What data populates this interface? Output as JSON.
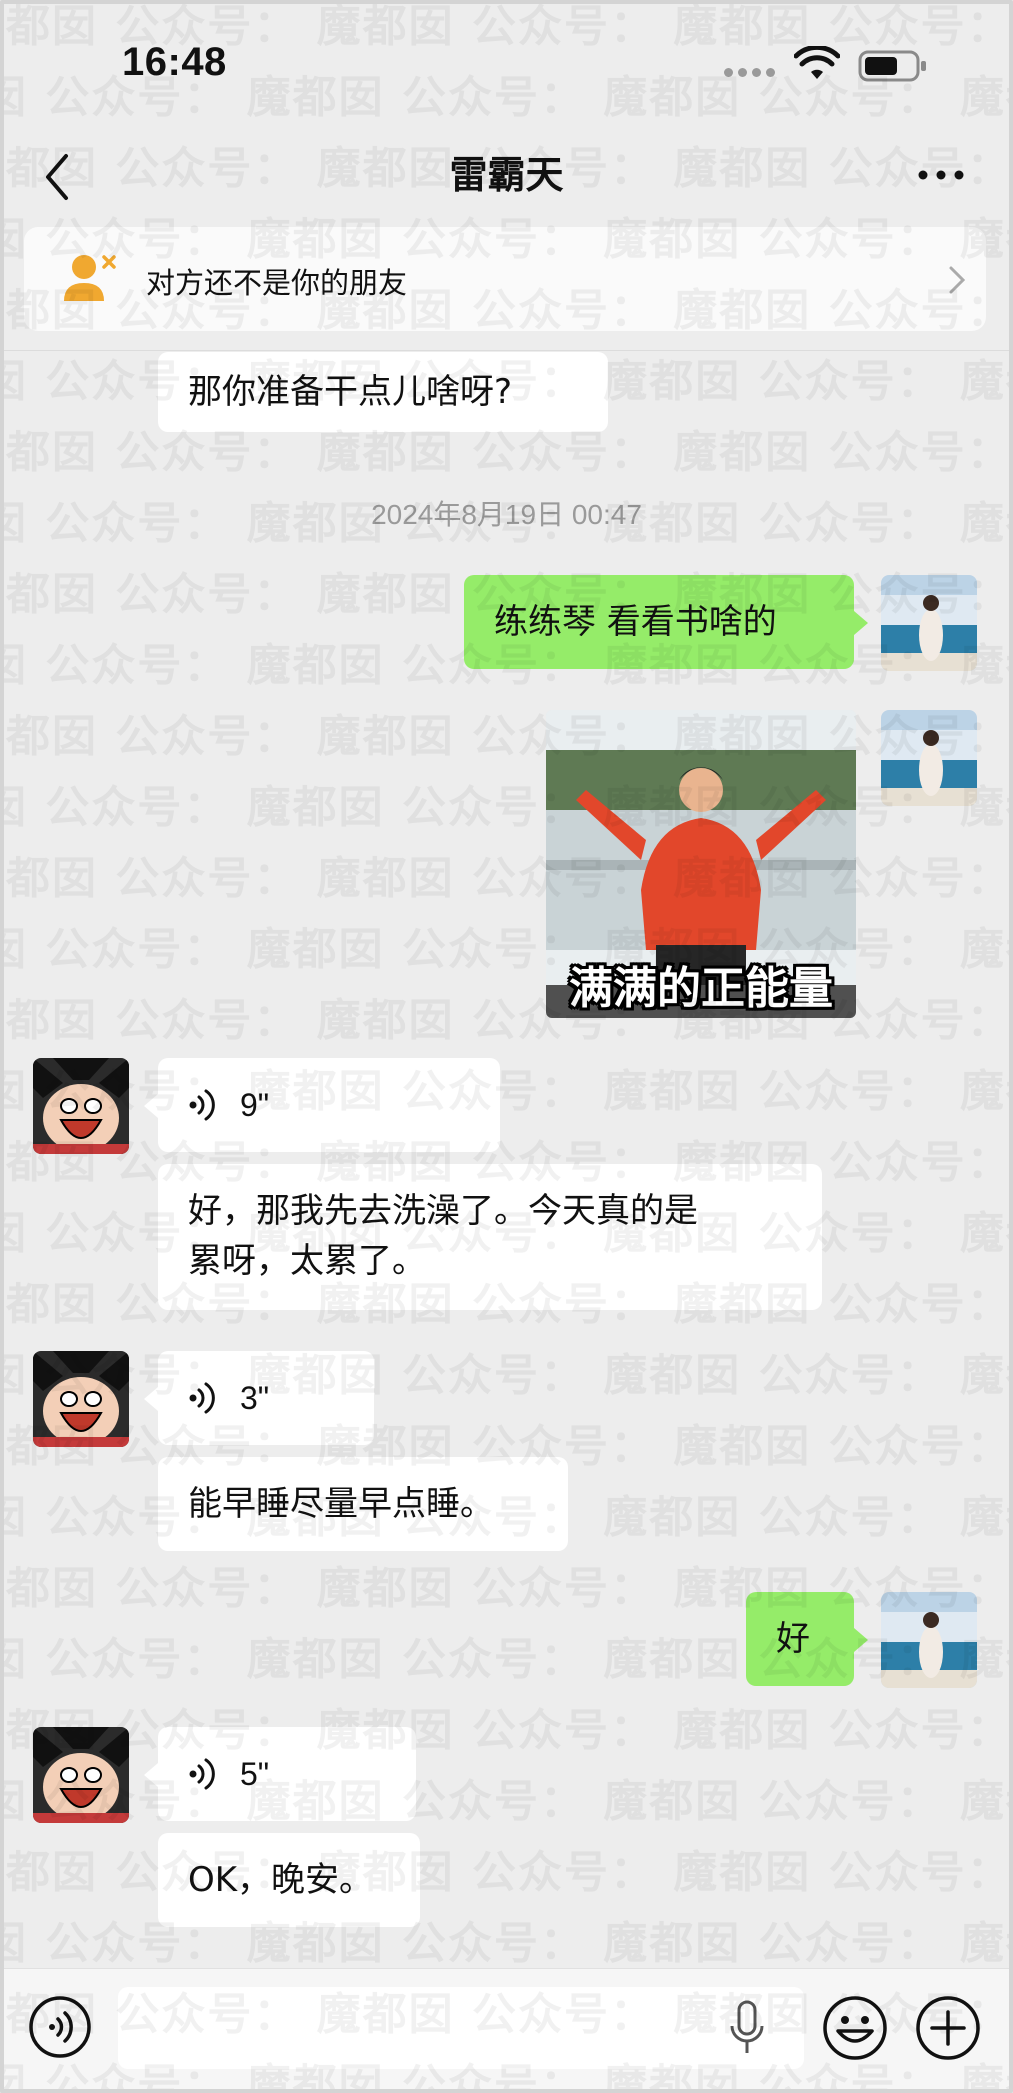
{
  "status_bar": {
    "time": "16:48"
  },
  "nav": {
    "title": "雷霸天"
  },
  "banner": {
    "text": "对方还不是你的朋友"
  },
  "messages": {
    "m1": "那你准备干点儿啥呀?",
    "timestamp": "2024年8月19日 00:47",
    "m2": "练练琴 看看书啥的",
    "sticker_caption": "满满的正能量",
    "v1": "9\"",
    "m3_line1": "好，那我先去洗澡了。今天真的是",
    "m3_line2": "累呀，太累了。",
    "v2": "3\"",
    "m4": "能早睡尽量早点睡。",
    "m5": "好",
    "v3": "5\"",
    "m6": "OK，晚安。"
  },
  "watermark": {
    "text": "魔都囡  公众号："
  },
  "colors": {
    "sent_bubble": "#95ec69",
    "received_bubble": "#ffffff",
    "background": "#ededed"
  },
  "icons": [
    "back-icon",
    "more-icon",
    "person-x-icon",
    "chevron-right-icon",
    "voice-wave-icon",
    "mic-icon",
    "emoji-icon",
    "plus-icon",
    "wifi-icon",
    "battery-icon"
  ]
}
